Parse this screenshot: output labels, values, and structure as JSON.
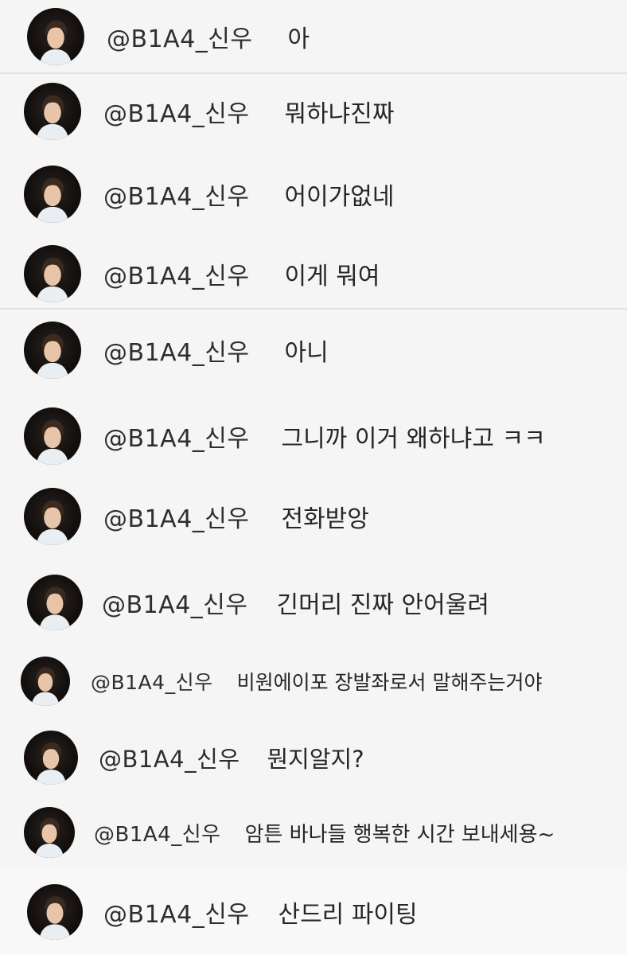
{
  "comment_list": {
    "items": [
      {
        "handle": "@B1A4_신우",
        "text": "아"
      },
      {
        "handle": "@B1A4_신우",
        "text": "뭐하냐진짜"
      },
      {
        "handle": "@B1A4_신우",
        "text": "어이가없네"
      },
      {
        "handle": "@B1A4_신우",
        "text": "이게 뭐여"
      },
      {
        "handle": "@B1A4_신우",
        "text": "아니"
      },
      {
        "handle": "@B1A4_신우",
        "text": "그니까 이거 왜하냐고 ㅋㅋ"
      },
      {
        "handle": "@B1A4_신우",
        "text": "전화받앙"
      },
      {
        "handle": "@B1A4_신우",
        "text": "긴머리 진짜 안어울려"
      },
      {
        "handle": "@B1A4_신우",
        "text": "비원에이포 장발좌로서 말해주는거야"
      },
      {
        "handle": "@B1A4_신우",
        "text": "뭔지알지?"
      },
      {
        "handle": "@B1A4_신우",
        "text": "암튼 바나들 행복한 시간 보내세용~"
      },
      {
        "handle": "@B1A4_신우",
        "text": "산드리 파이팅"
      }
    ]
  },
  "icons": {
    "avatar": "profile-photo-avatar"
  },
  "colors": {
    "background": "#f5f5f5",
    "text": "#262626",
    "divider": "#e2e2e2"
  }
}
